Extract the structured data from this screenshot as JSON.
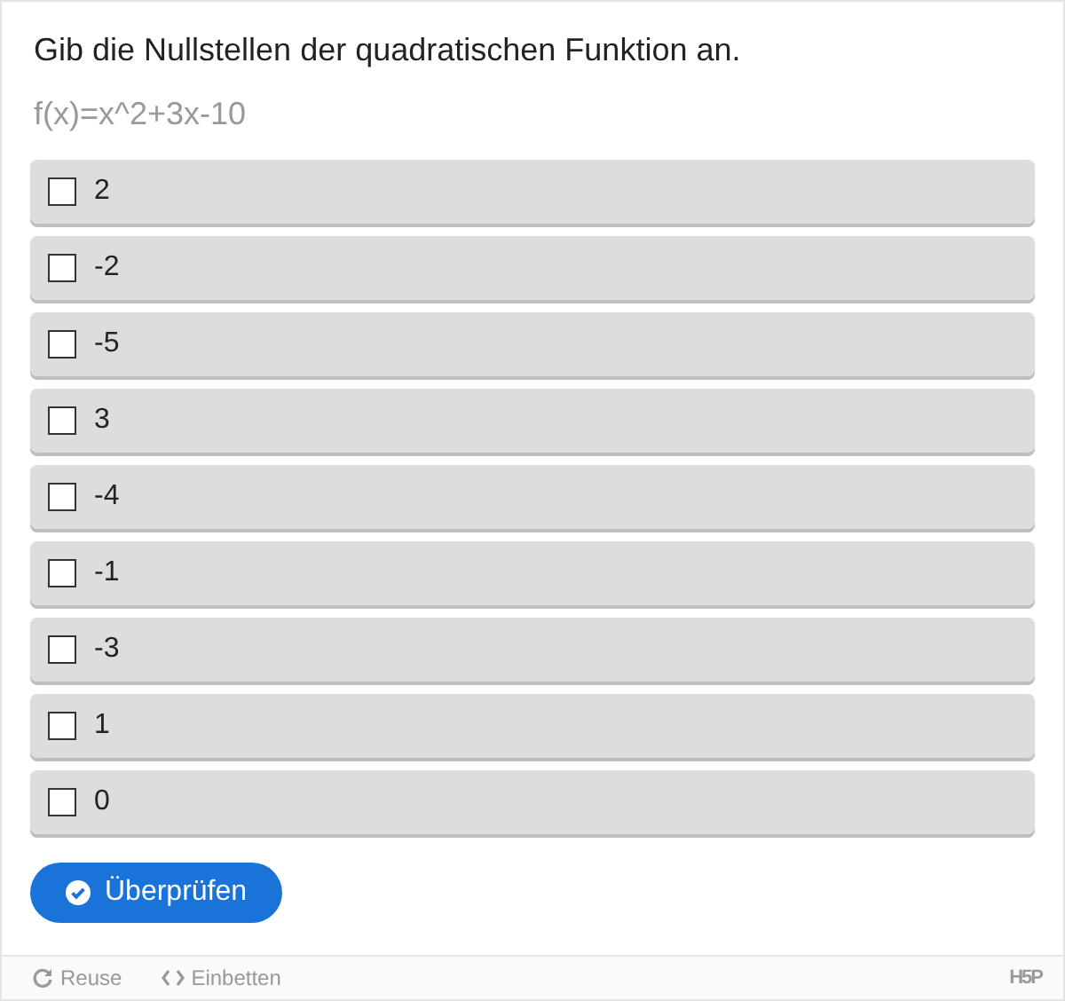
{
  "question": "Gib die Nullstellen der quadratischen Funktion an.",
  "formula": "f(x)=x^2+3x-10",
  "options": [
    {
      "label": "2",
      "checked": false
    },
    {
      "label": "-2",
      "checked": false
    },
    {
      "label": "-5",
      "checked": false
    },
    {
      "label": "3",
      "checked": false
    },
    {
      "label": "-4",
      "checked": false
    },
    {
      "label": "-1",
      "checked": false
    },
    {
      "label": "-3",
      "checked": false
    },
    {
      "label": "1",
      "checked": false
    },
    {
      "label": "0",
      "checked": false
    }
  ],
  "check_button": "Überprüfen",
  "footer": {
    "links": [
      {
        "kind": "reuse",
        "label": "Reuse"
      },
      {
        "kind": "embed",
        "label": "Einbetten"
      }
    ],
    "logo": "H5P"
  }
}
